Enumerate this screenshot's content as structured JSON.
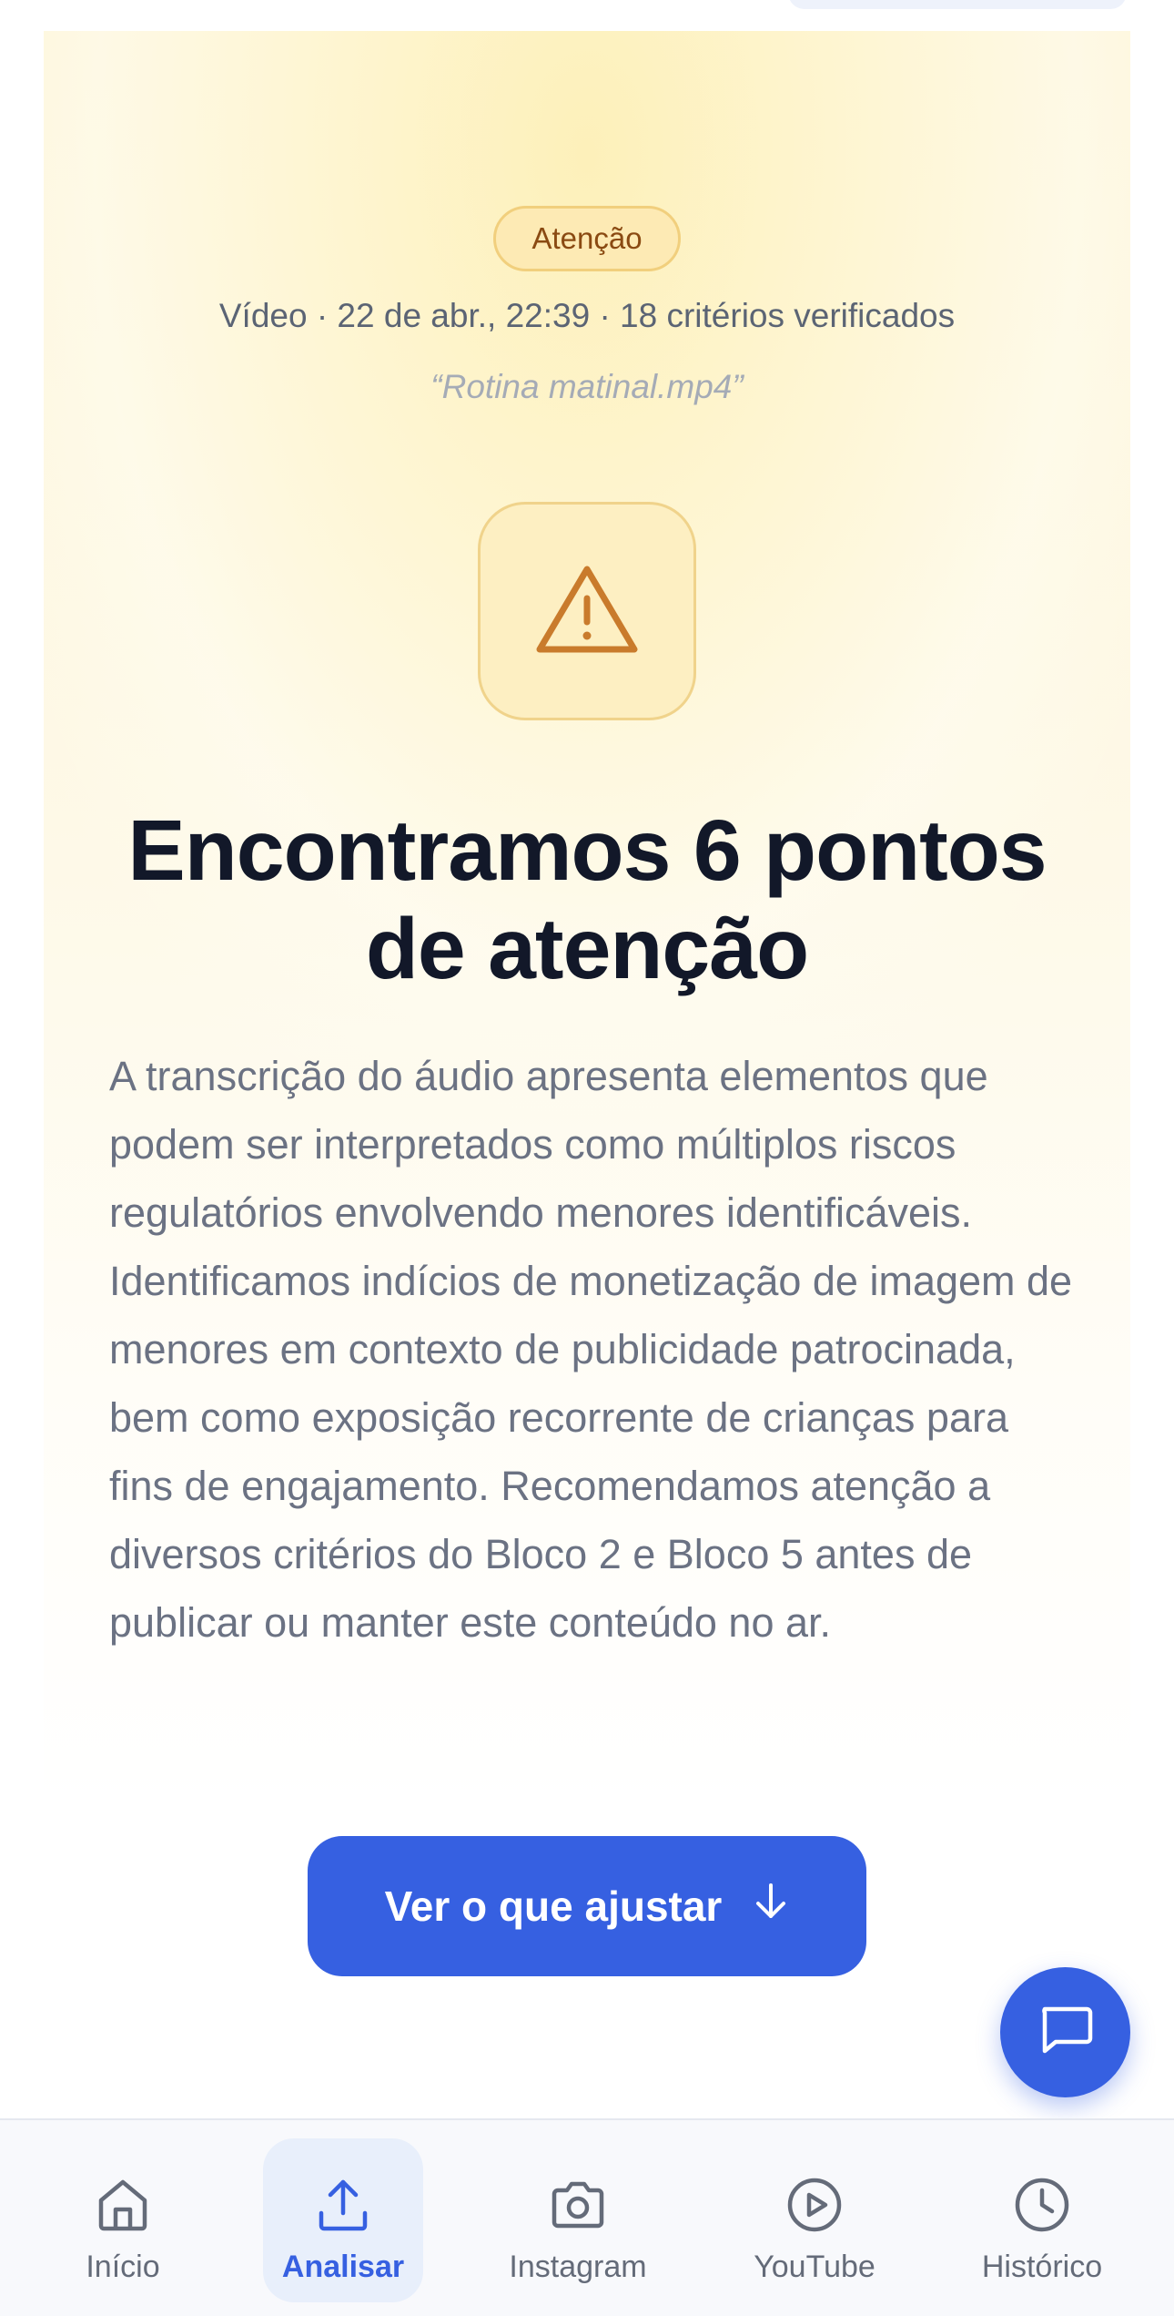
{
  "result": {
    "badge": "Atenção",
    "meta": "Vídeo · 22 de abr., 22:39 · 18 critérios verificados",
    "file_name": "“Rotina matinal.mp4”",
    "headline_line1": "Encontramos 6 pontos",
    "headline_line2": "de atenção",
    "description": "A transcrição do áudio apresenta elementos que podem ser interpretados como múltiplos riscos regulatórios envolvendo menores identificáveis. Identificamos indícios de monetização de imagem de menores em contexto de publicidade patrocinada, bem como exposição recorrente de crianças para fins de engajamento. Recomendamos atenção a diversos critérios do Bloco 2 e Bloco 5 antes de publicar ou manter este conteúdo no ar.",
    "cta_label": "Ver o que ajustar",
    "status_icon": "warning-triangle-icon"
  },
  "fab": {
    "icon": "chat-bubble-icon"
  },
  "nav": {
    "items": [
      {
        "label": "Início",
        "icon": "home-icon",
        "active": false
      },
      {
        "label": "Analisar",
        "icon": "upload-icon",
        "active": true
      },
      {
        "label": "Instagram",
        "icon": "camera-icon",
        "active": false
      },
      {
        "label": "YouTube",
        "icon": "play-circle-icon",
        "active": false
      },
      {
        "label": "Histórico",
        "icon": "clock-icon",
        "active": false
      }
    ]
  },
  "colors": {
    "accent": "#3660e1",
    "warning_text": "#8a4a12",
    "warning_icon": "#c97b2c",
    "headline": "#121829",
    "body_text": "#6b7283"
  }
}
